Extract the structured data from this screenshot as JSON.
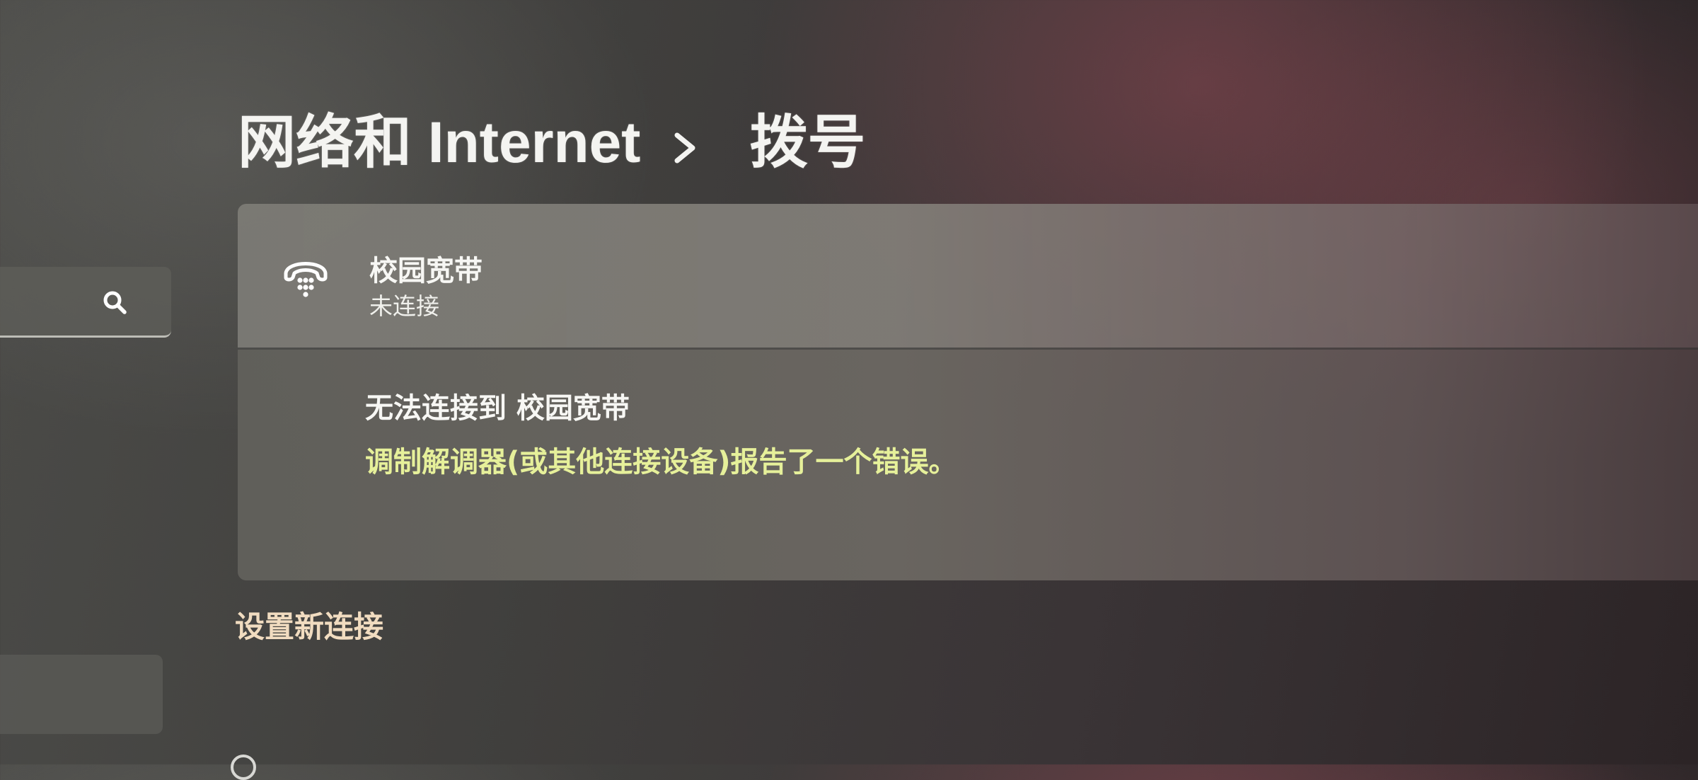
{
  "breadcrumb": {
    "parent": "网络和 Internet",
    "current": "拨号"
  },
  "search": {
    "placeholder": ""
  },
  "connection": {
    "name": "校园宽带",
    "status": "未连接",
    "error_title": "无法连接到 校园宽带",
    "error_message": "调制解调器(或其他连接设备)报告了一个错误。"
  },
  "actions": {
    "setup_new_connection": "设置新连接"
  },
  "icons": {
    "search": "search-icon",
    "dialup": "dialup-phone-icon",
    "breadcrumb_separator": "chevron-right-icon"
  },
  "colors": {
    "error_text": "#e6f09a",
    "link_text": "#f1dcc0"
  }
}
